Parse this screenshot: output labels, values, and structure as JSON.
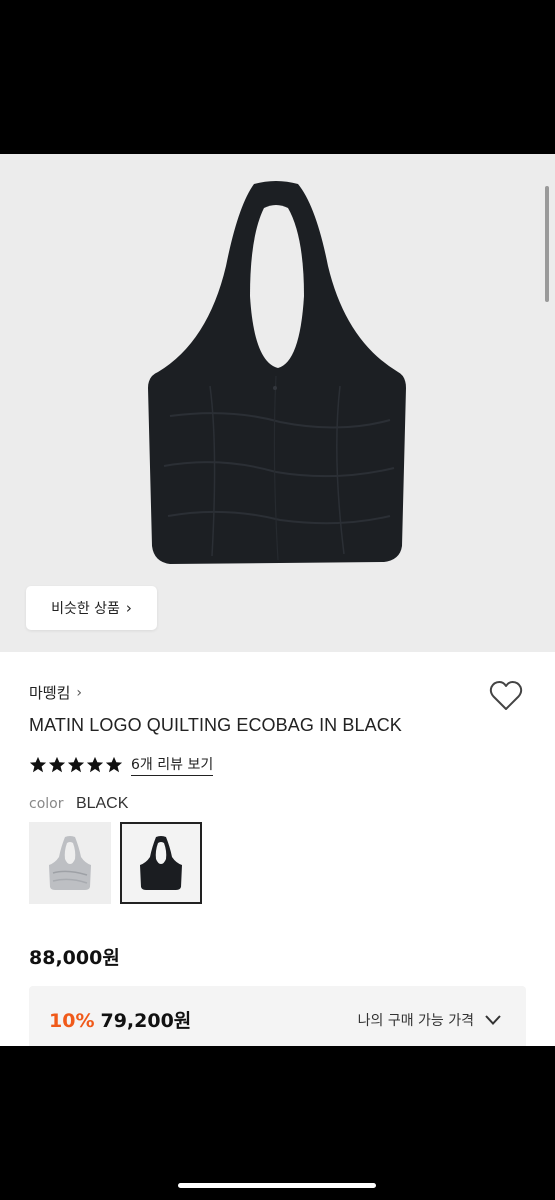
{
  "hero": {
    "similar_label": "비슷한 상품"
  },
  "product": {
    "brand": "마뗑킴",
    "title": "MATIN LOGO QUILTING ECOBAG IN BLACK",
    "rating_stars": 5,
    "review_label": "6개 리뷰 보기",
    "color_label": "color",
    "color_value": "BLACK",
    "swatches": [
      {
        "name": "silver"
      },
      {
        "name": "black",
        "selected": true
      }
    ],
    "price": "88,000원"
  },
  "discount": {
    "percent": "10%",
    "price": "79,200원",
    "my_price_label": "나의 구매 가능 가격"
  },
  "colors": {
    "accent_orange": "#f05a1a",
    "star": "#111111"
  }
}
